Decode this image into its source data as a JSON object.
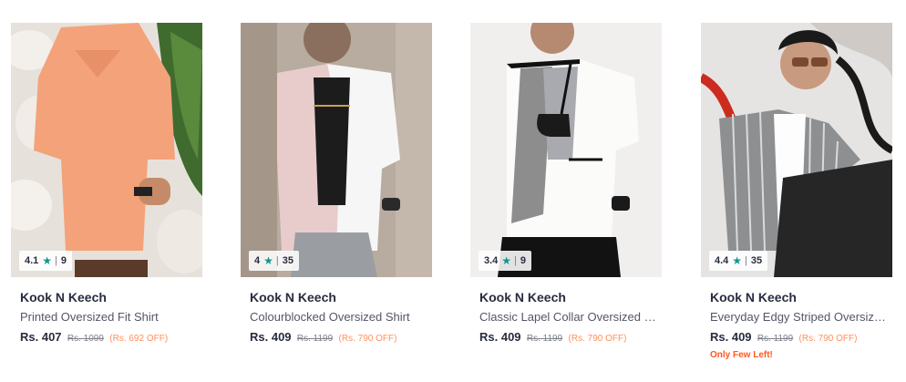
{
  "colors": {
    "rating_star": "#14958f",
    "discount": "#ff905a",
    "alert": "#ff5722"
  },
  "products": [
    {
      "rating": "4.1",
      "star_icon": "star-icon",
      "reviews": "9",
      "brand": "Kook N Keech",
      "name": "Printed Oversized Fit Shirt",
      "price": "Rs. 407",
      "mrp": "Rs. 1099",
      "discount": "(Rs. 692 OFF)",
      "alert": ""
    },
    {
      "rating": "4",
      "star_icon": "star-icon",
      "reviews": "35",
      "brand": "Kook N Keech",
      "name": "Colourblocked Oversized Shirt",
      "price": "Rs. 409",
      "mrp": "Rs. 1199",
      "discount": "(Rs. 790 OFF)",
      "alert": ""
    },
    {
      "rating": "3.4",
      "star_icon": "star-icon",
      "reviews": "9",
      "brand": "Kook N Keech",
      "name": "Classic Lapel Collar Oversized Shirt",
      "price": "Rs. 409",
      "mrp": "Rs. 1199",
      "discount": "(Rs. 790 OFF)",
      "alert": ""
    },
    {
      "rating": "4.4",
      "star_icon": "star-icon",
      "reviews": "35",
      "brand": "Kook N Keech",
      "name": "Everyday Edgy Striped Oversized Shirt",
      "price": "Rs. 409",
      "mrp": "Rs. 1199",
      "discount": "(Rs. 790 OFF)",
      "alert": "Only Few Left!"
    }
  ]
}
